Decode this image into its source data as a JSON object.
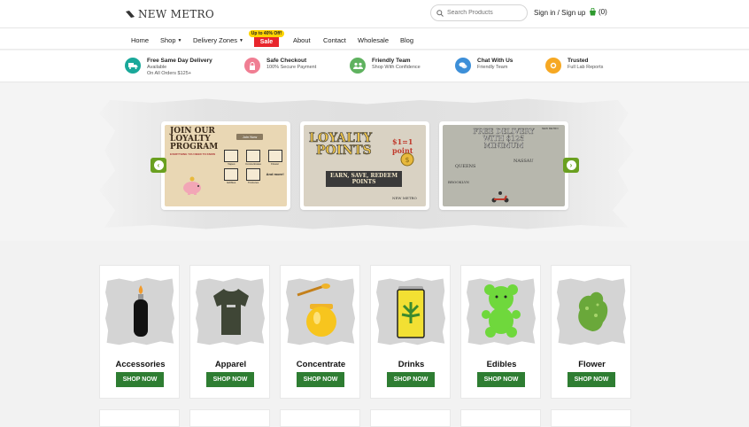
{
  "header": {
    "logo_text": "NEW METRO",
    "search_placeholder": "Search Products",
    "signin_label": "Sign in / Sign up",
    "cart_count": "(0)"
  },
  "nav": {
    "items": [
      "Home",
      "Shop",
      "Delivery Zones",
      "About",
      "Contact",
      "Wholesale",
      "Blog"
    ],
    "sale_flag": "Up to 40% Off!",
    "sale_label": "Sale"
  },
  "features": [
    {
      "title": "Free Same Day Delivery",
      "sub1": "Available",
      "sub2": "On All Orders $125+",
      "color": "#1aa89a",
      "icon": "truck-icon"
    },
    {
      "title": "Safe Checkout",
      "sub1": "100% Secure Payment",
      "sub2": "",
      "color": "#f07e93",
      "icon": "lock-icon"
    },
    {
      "title": "Friendly Team",
      "sub1": "Shop With Confidence",
      "sub2": "",
      "color": "#5fb25f",
      "icon": "team-icon"
    },
    {
      "title": "Chat With Us",
      "sub1": "Friendly Team",
      "sub2": "",
      "color": "#3d8fd8",
      "icon": "chat-icon"
    },
    {
      "title": "Trusted",
      "sub1": "Full Lab Reports",
      "sub2": "",
      "color": "#f6a823",
      "icon": "badge-icon"
    }
  ],
  "slides": {
    "loyalty_program": {
      "title1": "JOIN OUR",
      "title2": "LOYALTY",
      "title3": "PROGRAM",
      "sub": "EVERYTHING YOU NEED TO KNOW",
      "join": "Join Now",
      "items": [
        "Vapes",
        "Concentrates",
        "Flower",
        "Edibles",
        "Tinctures",
        "And more!"
      ]
    },
    "loyalty_points": {
      "title1": "LOYALTY",
      "title2": "POINTS",
      "badge": "$1=1 point",
      "sub1": "EARN, SAVE, REDEEM",
      "sub2": "POINTS",
      "brand": "NEW METRO"
    },
    "free_delivery": {
      "title1": "FREE DELIVERY",
      "title2": "WITH $125",
      "title3": "MINIMUM",
      "places": [
        "QUEENS",
        "NASSAU",
        "BROOKLYN"
      ],
      "brand": "NEW METRO"
    }
  },
  "categories": [
    {
      "name": "Accessories",
      "button": "SHOP NOW",
      "icon": "lighter-icon"
    },
    {
      "name": "Apparel",
      "button": "SHOP NOW",
      "icon": "tshirt-icon"
    },
    {
      "name": "Concentrate",
      "button": "SHOP NOW",
      "icon": "honey-jar-icon"
    },
    {
      "name": "Drinks",
      "button": "SHOP NOW",
      "icon": "can-icon"
    },
    {
      "name": "Edibles",
      "button": "SHOP NOW",
      "icon": "gummy-bear-icon"
    },
    {
      "name": "Flower",
      "button": "SHOP NOW",
      "icon": "flower-bud-icon"
    }
  ]
}
